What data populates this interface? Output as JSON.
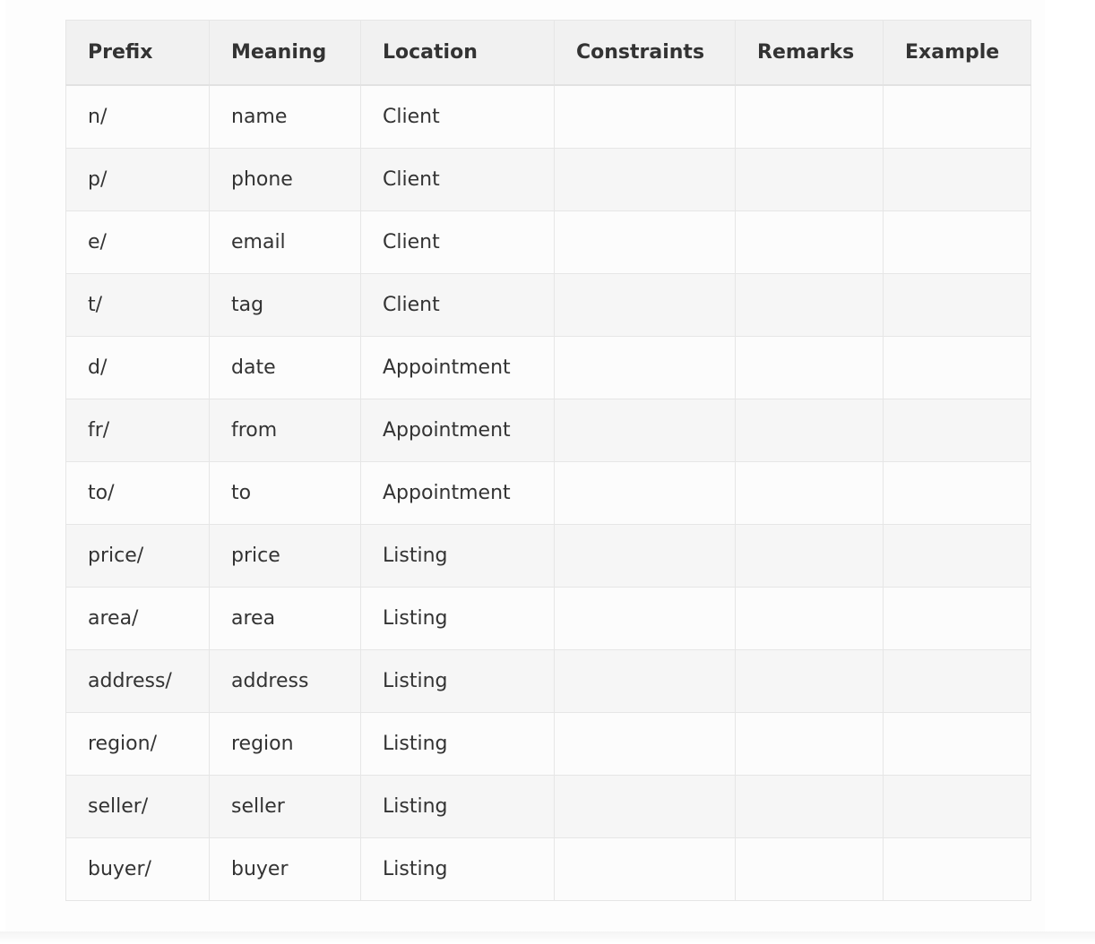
{
  "table": {
    "headers": [
      "Prefix",
      "Meaning",
      "Location",
      "Constraints",
      "Remarks",
      "Example"
    ],
    "rows": [
      [
        "n/",
        "name",
        "Client",
        "",
        "",
        ""
      ],
      [
        "p/",
        "phone",
        "Client",
        "",
        "",
        ""
      ],
      [
        "e/",
        "email",
        "Client",
        "",
        "",
        ""
      ],
      [
        "t/",
        "tag",
        "Client",
        "",
        "",
        ""
      ],
      [
        "d/",
        "date",
        "Appointment",
        "",
        "",
        ""
      ],
      [
        "fr/",
        "from",
        "Appointment",
        "",
        "",
        ""
      ],
      [
        "to/",
        "to",
        "Appointment",
        "",
        "",
        ""
      ],
      [
        "price/",
        "price",
        "Listing",
        "",
        "",
        ""
      ],
      [
        "area/",
        "area",
        "Listing",
        "",
        "",
        ""
      ],
      [
        "address/",
        "address",
        "Listing",
        "",
        "",
        ""
      ],
      [
        "region/",
        "region",
        "Listing",
        "",
        "",
        ""
      ],
      [
        "seller/",
        "seller",
        "Listing",
        "",
        "",
        ""
      ],
      [
        "buyer/",
        "buyer",
        "Listing",
        "",
        "",
        ""
      ]
    ]
  }
}
